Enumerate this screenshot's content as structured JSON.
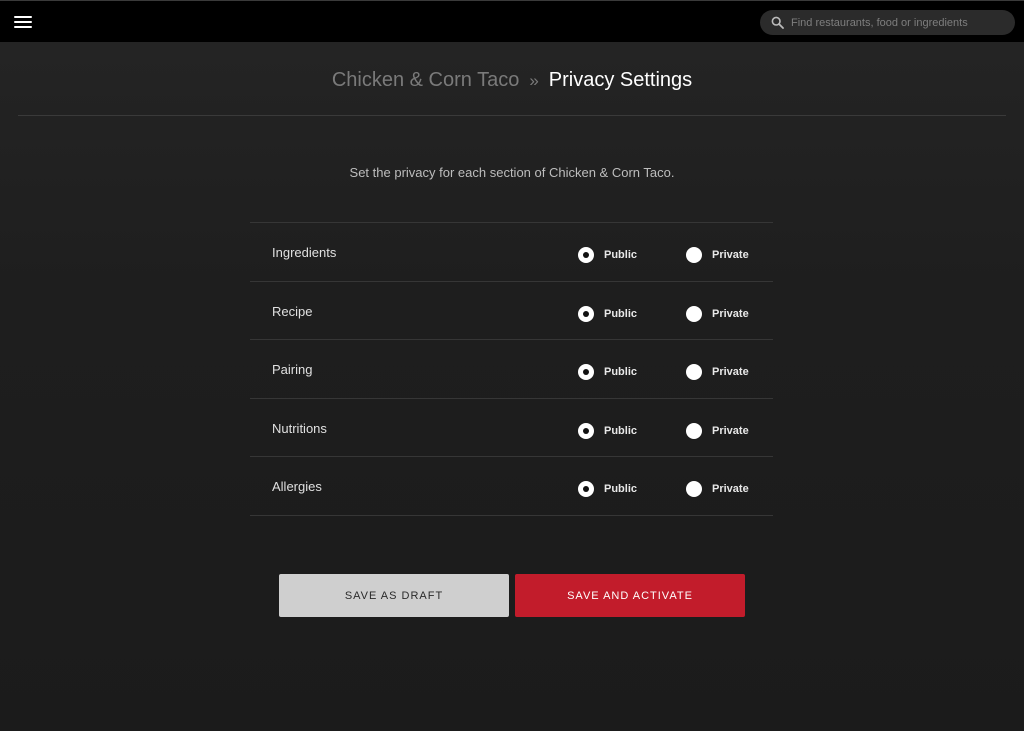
{
  "header": {
    "menu_icon": "hamburger-menu-icon",
    "search": {
      "icon": "search-icon",
      "placeholder": "Find restaurants, food or ingredients",
      "value": ""
    }
  },
  "title": {
    "breadcrumb": "Chicken & Corn Taco",
    "separator": "»",
    "current": "Privacy Settings"
  },
  "intro": "Set the privacy for each section of Chicken & Corn Taco.",
  "options": {
    "public_label": "Public",
    "private_label": "Private"
  },
  "sections": [
    {
      "label": "Ingredients",
      "selected": "public"
    },
    {
      "label": "Recipe",
      "selected": "public"
    },
    {
      "label": "Pairing",
      "selected": "public"
    },
    {
      "label": "Nutritions",
      "selected": "public"
    },
    {
      "label": "Allergies",
      "selected": "public"
    }
  ],
  "buttons": {
    "draft_label": "SAVE AS DRAFT",
    "activate_label": "SAVE AND ACTIVATE"
  },
  "colors": {
    "accent": "#c21c2b",
    "draft_button": "#cfcfcf",
    "topbar": "#000000"
  }
}
